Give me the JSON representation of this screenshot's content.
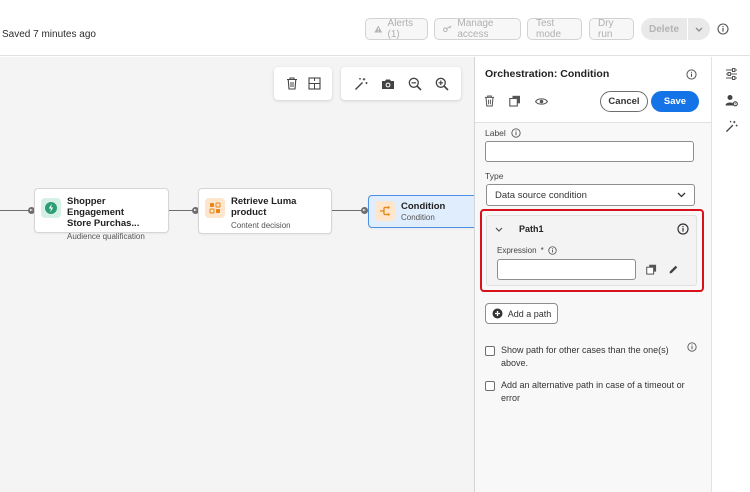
{
  "header": {
    "saved_status": "Saved 7 minutes ago",
    "buttons": {
      "alerts": "Alerts (1)",
      "manage_access": "Manage access",
      "test_mode": "Test mode",
      "dry_run": "Dry run",
      "delete": "Delete"
    }
  },
  "canvas": {
    "nodes": [
      {
        "title_line1": "Shopper Engagement",
        "title_line2": "Store Purchas...",
        "subtitle": "Audience qualification",
        "icon": "audience-icon",
        "icon_color": "#2d9d78"
      },
      {
        "title_line1": "Retrieve Luma",
        "title_line2": "product",
        "subtitle": "Content decision",
        "icon": "content-decision-icon",
        "icon_color": "#e68619"
      },
      {
        "title_line1": "Condition",
        "subtitle": "Condition",
        "icon": "condition-icon",
        "icon_color": "#e68619"
      }
    ]
  },
  "panel": {
    "title": "Orchestration: Condition",
    "cancel": "Cancel",
    "save": "Save",
    "label_field": {
      "label": "Label",
      "value": ""
    },
    "type_field": {
      "label": "Type",
      "selected": "Data source condition"
    },
    "path": {
      "name": "Path1",
      "expression_label": "Expression",
      "required_marker": "*",
      "expression_value": ""
    },
    "add_path": "Add a path",
    "options": [
      {
        "line1": "Show path for other cases than the one(s)",
        "line2": "above.",
        "checked": false
      },
      {
        "line1": "Add an alternative path in case of a timeout or",
        "line2": "error",
        "checked": false
      }
    ]
  },
  "colors": {
    "accent": "#1473e6",
    "highlight_outline": "#d9111c",
    "selected_node_fill": "#dfedfd"
  }
}
